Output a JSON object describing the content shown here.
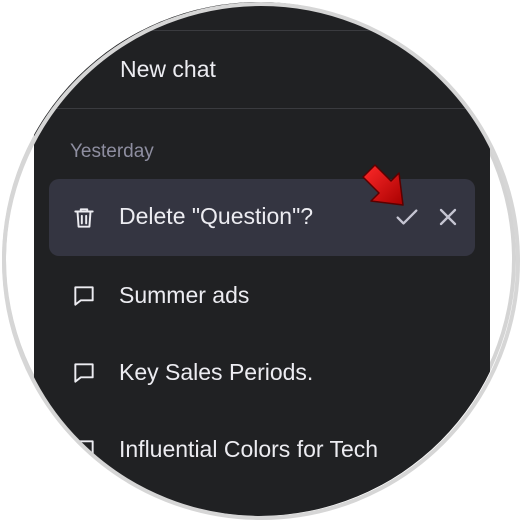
{
  "sidebar": {
    "new_chat_label": "New chat",
    "section_label": "Yesterday",
    "delete_prompt": "Delete \"Question\"?",
    "items": [
      {
        "label": "Summer ads",
        "icon": "chat-bubble-icon"
      },
      {
        "label": "Key Sales Periods.",
        "icon": "chat-bubble-icon"
      },
      {
        "label": "Influential Colors for Tech",
        "icon": "chat-bubble-icon"
      }
    ]
  },
  "icons": {
    "delete": "trash-icon",
    "confirm": "check-icon",
    "cancel": "close-icon",
    "pointer": "red-arrow-icon"
  },
  "colors": {
    "sidebar_bg": "#202123",
    "active_row_bg": "#343541",
    "text": "#ececf1",
    "muted_text": "#8e8ea0",
    "arrow": "#d40000"
  }
}
